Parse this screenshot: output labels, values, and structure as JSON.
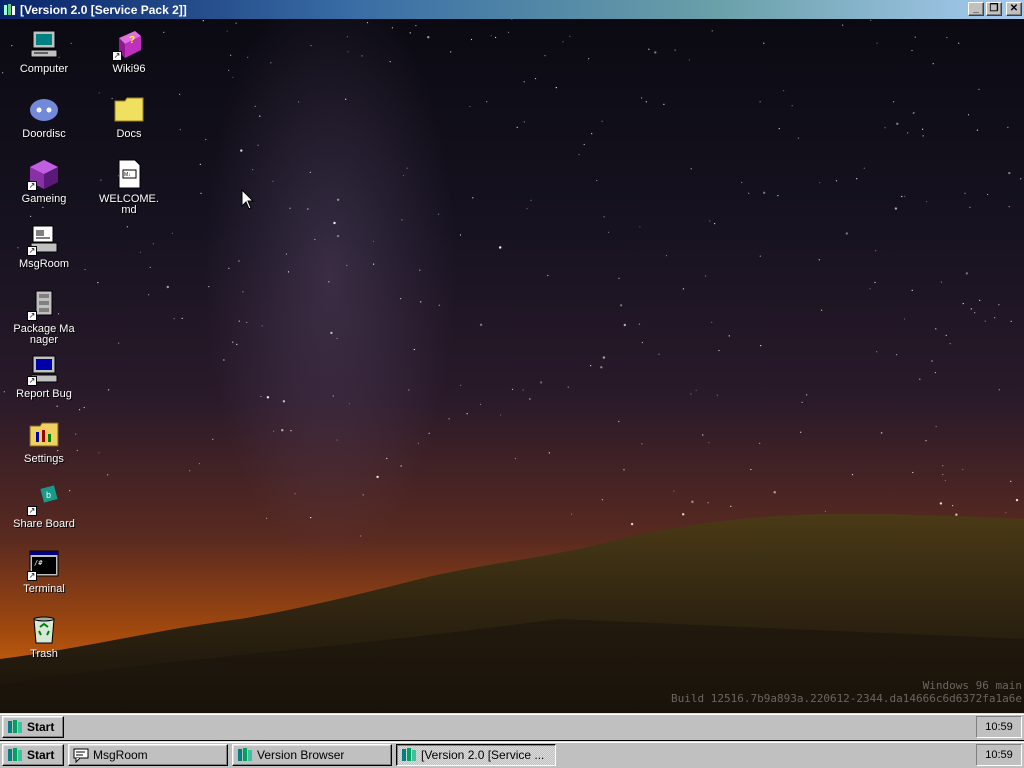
{
  "window": {
    "title": "[Version 2.0 [Service Pack 2]]",
    "controls": {
      "minimize": "_",
      "restore": "❐",
      "close": "✕"
    }
  },
  "desktop": {
    "icons": [
      {
        "label": "Computer",
        "icon": "computer-icon"
      },
      {
        "label": "Wiki96",
        "icon": "help-book-icon"
      },
      {
        "label": "Doordisc",
        "icon": "discord-icon"
      },
      {
        "label": "Docs",
        "icon": "folder-icon"
      },
      {
        "label": "Gameing",
        "icon": "game-cube-icon"
      },
      {
        "label": "WELCOME.md",
        "icon": "markdown-file-icon"
      },
      {
        "label": "MsgRoom",
        "icon": "chat-icon"
      },
      {
        "label": "Package Manager",
        "icon": "package-icon"
      },
      {
        "label": "Report Bug",
        "icon": "bug-report-icon"
      },
      {
        "label": "Settings",
        "icon": "settings-folder-icon"
      },
      {
        "label": "Share Board",
        "icon": "share-board-icon"
      },
      {
        "label": "Terminal",
        "icon": "terminal-icon"
      },
      {
        "label": "Trash",
        "icon": "recycle-bin-icon"
      }
    ],
    "shortcut_glyph": "↗",
    "watermark": {
      "line1": "Windows 96 main",
      "line2": "Build 12516.7b9a893a.220612-2344.da14666c6d6372fa1a6e"
    }
  },
  "inner_taskbar": {
    "start_label": "Start",
    "clock": "10:59"
  },
  "outer_taskbar": {
    "start_label": "Start",
    "tasks": [
      {
        "label": "MsgRoom",
        "icon": "chat-icon",
        "active": false
      },
      {
        "label": "Version Browser",
        "icon": "app-icon",
        "active": false
      },
      {
        "label": "[Version 2.0 [Service ...",
        "icon": "app-icon",
        "active": true
      }
    ],
    "clock": "10:59"
  },
  "colors": {
    "titlebar_start": "#0a246a",
    "titlebar_end": "#a6caf0",
    "taskbar": "#c0c0c0"
  }
}
